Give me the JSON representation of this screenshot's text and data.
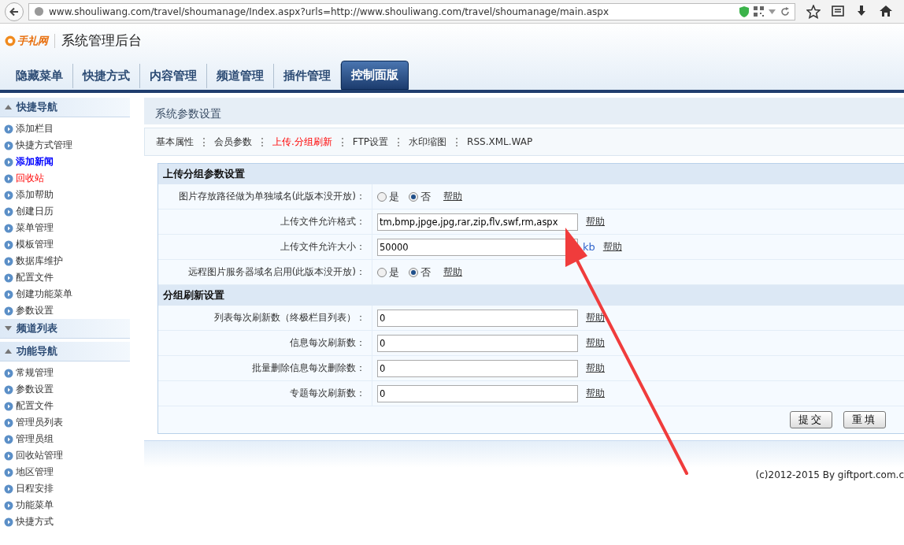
{
  "browser": {
    "url": "www.shouliwang.com/travel/shoumanage/Index.aspx?urls=http://www.shouliwang.com/travel/shoumanage/main.aspx"
  },
  "header": {
    "logo": "手礼网",
    "title": "系统管理后台"
  },
  "nav_tabs": [
    {
      "label": "隐藏菜单",
      "selected": false
    },
    {
      "label": "快捷方式",
      "selected": false
    },
    {
      "label": "内容管理",
      "selected": false
    },
    {
      "label": "频道管理",
      "selected": false
    },
    {
      "label": "插件管理",
      "selected": false
    },
    {
      "label": "控制面版",
      "selected": true
    }
  ],
  "sidebar": [
    {
      "title": "快捷导航",
      "expanded": true,
      "items": [
        {
          "label": "添加栏目",
          "selected": false,
          "kind": "normal"
        },
        {
          "label": "快捷方式管理",
          "selected": false,
          "kind": "normal"
        },
        {
          "label": "添加新闻",
          "selected": true,
          "kind": "normal"
        },
        {
          "label": "回收站",
          "selected": false,
          "kind": "warning"
        },
        {
          "label": "添加帮助",
          "selected": false,
          "kind": "normal"
        },
        {
          "label": "创建日历",
          "selected": false,
          "kind": "normal"
        },
        {
          "label": "菜单管理",
          "selected": false,
          "kind": "normal"
        },
        {
          "label": "模板管理",
          "selected": false,
          "kind": "normal"
        },
        {
          "label": "数据库维护",
          "selected": false,
          "kind": "normal"
        },
        {
          "label": "配置文件",
          "selected": false,
          "kind": "normal"
        },
        {
          "label": "创建功能菜单",
          "selected": false,
          "kind": "normal"
        },
        {
          "label": "参数设置",
          "selected": false,
          "kind": "normal"
        }
      ]
    },
    {
      "title": "频道列表",
      "expanded": false
    },
    {
      "title": "功能导航",
      "expanded": true,
      "items": [
        {
          "label": "常规管理",
          "selected": false,
          "kind": "normal"
        },
        {
          "label": "参数设置",
          "selected": false,
          "kind": "normal"
        },
        {
          "label": "配置文件",
          "selected": false,
          "kind": "normal"
        },
        {
          "label": "管理员列表",
          "selected": false,
          "kind": "normal"
        },
        {
          "label": "管理员组",
          "selected": false,
          "kind": "normal"
        },
        {
          "label": "回收站管理",
          "selected": false,
          "kind": "normal"
        },
        {
          "label": "地区管理",
          "selected": false,
          "kind": "normal"
        },
        {
          "label": "日程安排",
          "selected": false,
          "kind": "normal"
        },
        {
          "label": "功能菜单",
          "selected": false,
          "kind": "normal"
        },
        {
          "label": "快捷方式",
          "selected": false,
          "kind": "normal"
        }
      ]
    }
  ],
  "page_title": "系统参数设置",
  "sub_tabs": [
    {
      "label": "基本属性",
      "selected": false
    },
    {
      "label": "会员参数",
      "selected": false
    },
    {
      "label": "上传.分组刷新",
      "selected": true
    },
    {
      "label": "FTP设置",
      "selected": false
    },
    {
      "label": "水印缩图",
      "selected": false
    },
    {
      "label": "RSS.XML.WAP",
      "selected": false
    }
  ],
  "sections": [
    {
      "title": "上传分组参数设置",
      "rows": [
        {
          "kind": "radio",
          "label": "图片存放路径做为单独域名(此版本没开放)：",
          "options": [
            {
              "label": "是",
              "selected": false
            },
            {
              "label": "否",
              "selected": true
            }
          ],
          "help": "帮助"
        },
        {
          "kind": "input",
          "label": "上传文件允许格式：",
          "value": "tm,bmp,jpge,jpg,rar,zip,flv,swf,rm,aspx",
          "help": "帮助"
        },
        {
          "kind": "input",
          "label": "上传文件允许大小：",
          "value": "50000",
          "unit": "kb",
          "help": "帮助"
        },
        {
          "kind": "radio",
          "label": "远程图片服务器域名启用(此版本没开放)：",
          "options": [
            {
              "label": "是",
              "selected": false
            },
            {
              "label": "否",
              "selected": true
            }
          ],
          "help": "帮助"
        }
      ]
    },
    {
      "title": "分组刷新设置",
      "rows": [
        {
          "kind": "input",
          "label": "列表每次刷新数（终极栏目列表）：",
          "value": "0",
          "help": "帮助"
        },
        {
          "kind": "input",
          "label": "信息每次刷新数：",
          "value": "0",
          "help": "帮助"
        },
        {
          "kind": "input",
          "label": "批量删除信息每次删除数：",
          "value": "0",
          "help": "帮助"
        },
        {
          "kind": "input",
          "label": "专题每次刷新数：",
          "value": "0",
          "help": "帮助"
        }
      ]
    }
  ],
  "buttons": [
    "提交",
    "重填"
  ],
  "footer": "(c)2012-2015 By giftport.com.c"
}
